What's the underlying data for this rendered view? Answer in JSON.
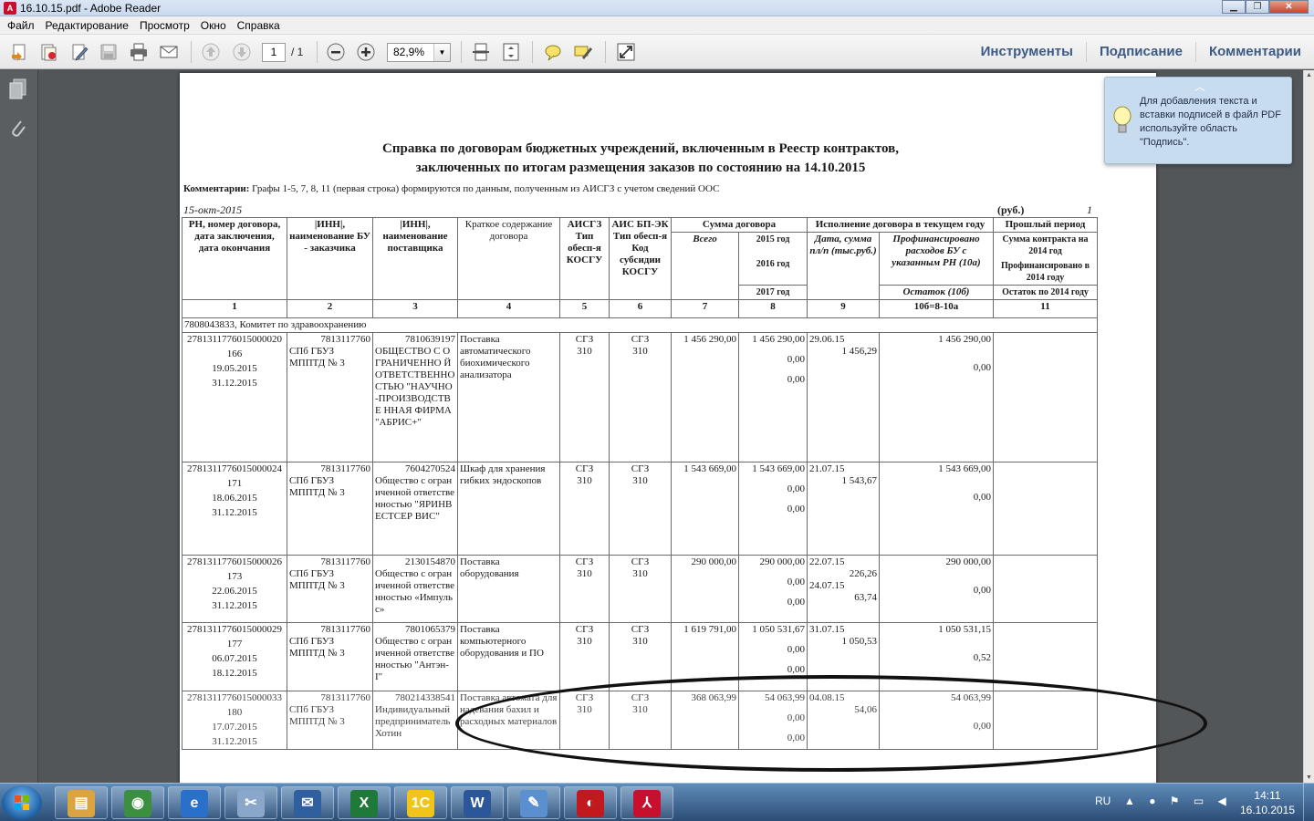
{
  "window": {
    "title": "16.10.15.pdf - Adobe Reader"
  },
  "menu": [
    "Файл",
    "Редактирование",
    "Просмотр",
    "Окно",
    "Справка"
  ],
  "toolbar": {
    "page_current": "1",
    "page_total": "/ 1",
    "zoom": "82,9%",
    "tabs": [
      "Инструменты",
      "Подписание",
      "Комментарии"
    ]
  },
  "tooltip": {
    "text": "Для добавления текста и вставки подписей в файл PDF используйте область \"Подпись\"."
  },
  "document": {
    "title_line1": "Справка по договорам бюджетных учреждений, включенным в Реестр контрактов,",
    "title_line2": "заключенных по итогам размещения заказов по состоянию на 14.10.2015",
    "comment_label": "Комментарии:",
    "comment_text": "Графы 1-5, 7, 8, 11 (первая строка) формируются по данным, полученным из АИСГЗ с учетом сведений ООС",
    "date": "15-окт-2015",
    "currency": "(руб.)",
    "page_no": "1",
    "headers": {
      "h1": "РН, номер договора, дата заключения, дата окончания",
      "h2": "|ИНН|, наименование БУ - заказчика",
      "h3": "|ИНН|, наименование поставщика",
      "h4": "Краткое содержание договора",
      "h5": "АИСГЗ Тип обесп-я КОСГУ",
      "h6": "АИС БП-ЭК Тип обесп-я Код субсидии КОСГУ",
      "h_sum": "Сумма договора",
      "h7": "Всего",
      "h8a": "2015 год",
      "h8b": "2016 год",
      "h8c": "2017 год",
      "h_exec": "Исполнение договора в текущем году",
      "h9": "Дата, сумма пл/п (тыс.руб.)",
      "h10a": "Профинансировано расходов БУ с указанным РН (10а)",
      "h10b": "Остаток (10б)",
      "h_prev": "Прошлый период",
      "h11a": "Сумма контракта на 2014 год",
      "h11b": "Профинансировано в 2014 году",
      "h11c": "Остаток по 2014 году"
    },
    "col_numbers": [
      "1",
      "2",
      "3",
      "4",
      "5",
      "6",
      "7",
      "8",
      "9",
      "10б=8-10а",
      "11"
    ],
    "group": "7808043833, Комитет по здравоохранению",
    "rows": [
      {
        "rn": "2781311776015000020",
        "num": "166",
        "d1": "19.05.2015",
        "d2": "31.12.2015",
        "inn_bu": "7813117760",
        "bu": "СПб ГБУЗ МППТД № 3",
        "inn_sup": "7810639197",
        "sup": "ОБЩЕСТВО С ОГРАНИЧЕННО Й ОТВЕТСТВЕННО СТЬЮ \"НАУЧНО-ПРОИЗВОДСТВЕ ННАЯ ФИРМА \"АБРИС+\"",
        "desc": "Поставка автоматического биохимического анализатора",
        "t5a": "СГЗ",
        "t5b": "310",
        "t6a": "СГЗ",
        "t6b": "310",
        "total": "1 456 290,00",
        "y2015": "1 456 290,00",
        "y2016": "0,00",
        "y2017": "0,00",
        "pay_date": "29.06.15",
        "pay_sum": "1 456,29",
        "pay_date2": "",
        "pay_sum2": "",
        "fin": "1 456 290,00",
        "rest": "0,00"
      },
      {
        "rn": "2781311776015000024",
        "num": "171",
        "d1": "18.06.2015",
        "d2": "31.12.2015",
        "inn_bu": "7813117760",
        "bu": "СПб ГБУЗ МППТД № 3",
        "inn_sup": "7604270524",
        "sup": "Общество с ограниченной ответственностью \"ЯРИНВЕСТСЕР ВИС\"",
        "desc": "Шкаф для хранения гибких эндоскопов",
        "t5a": "СГЗ",
        "t5b": "310",
        "t6a": "СГЗ",
        "t6b": "310",
        "total": "1 543 669,00",
        "y2015": "1 543 669,00",
        "y2016": "0,00",
        "y2017": "0,00",
        "pay_date": "21.07.15",
        "pay_sum": "1 543,67",
        "pay_date2": "",
        "pay_sum2": "",
        "fin": "1 543 669,00",
        "rest": "0,00"
      },
      {
        "rn": "2781311776015000026",
        "num": "173",
        "d1": "22.06.2015",
        "d2": "31.12.2015",
        "inn_bu": "7813117760",
        "bu": "СПб ГБУЗ МППТД № 3",
        "inn_sup": "2130154870",
        "sup": "Общество с ограниченной ответственностью «Импульс»",
        "desc": "Поставка оборудования",
        "t5a": "СГЗ",
        "t5b": "310",
        "t6a": "СГЗ",
        "t6b": "310",
        "total": "290 000,00",
        "y2015": "290 000,00",
        "y2016": "0,00",
        "y2017": "0,00",
        "pay_date": "22.07.15",
        "pay_sum": "226,26",
        "pay_date2": "24.07.15",
        "pay_sum2": "63,74",
        "fin": "290 000,00",
        "rest": "0,00"
      },
      {
        "rn": "2781311776015000029",
        "num": "177",
        "d1": "06.07.2015",
        "d2": "18.12.2015",
        "inn_bu": "7813117760",
        "bu": "СПб ГБУЗ МППТД № 3",
        "inn_sup": "7801065379",
        "sup": "Общество с ограниченной ответственностью \"Антэн-I\"",
        "desc": "Поставка компьютерного оборудования и ПО",
        "t5a": "СГЗ",
        "t5b": "310",
        "t6a": "СГЗ",
        "t6b": "310",
        "total": "1 619 791,00",
        "y2015": "1 050 531,67",
        "y2016": "0,00",
        "y2017": "0,00",
        "pay_date": "31.07.15",
        "pay_sum": "1 050,53",
        "pay_date2": "",
        "pay_sum2": "",
        "fin": "1 050 531,15",
        "rest": "0,52"
      },
      {
        "rn": "2781311776015000033",
        "num": "180",
        "d1": "17.07.2015",
        "d2": "31.12.2015",
        "inn_bu": "7813117760",
        "bu": "СПб ГБУЗ МППТД № 3",
        "inn_sup": "780214338541",
        "sup": "Индивидуальный предприниматель Хотин",
        "desc": "Поставка автомата для надевания бахил и расходных материалов",
        "t5a": "СГЗ",
        "t5b": "310",
        "t6a": "СГЗ",
        "t6b": "310",
        "total": "368 063,99",
        "y2015": "54 063,99",
        "y2016": "0,00",
        "y2017": "0,00",
        "pay_date": "04.08.15",
        "pay_sum": "54,06",
        "pay_date2": "",
        "pay_sum2": "",
        "fin": "54 063,99",
        "rest": "0,00"
      }
    ]
  },
  "taskbar": {
    "lang": "RU",
    "time": "14:11",
    "date": "16.10.2015",
    "apps": [
      {
        "icon": "file-explorer-icon",
        "color": "#d9a441"
      },
      {
        "icon": "chrome-icon",
        "color": "#3b8f3f"
      },
      {
        "icon": "internet-explorer-icon",
        "color": "#2a6fc9"
      },
      {
        "icon": "snipping-tool-icon",
        "color": "#8aa6c8"
      },
      {
        "icon": "mail-client-icon",
        "color": "#2f5f9e"
      },
      {
        "icon": "excel-icon",
        "color": "#1f7a3a"
      },
      {
        "icon": "1c-icon",
        "color": "#f0c419"
      },
      {
        "icon": "word-icon",
        "color": "#2b579a"
      },
      {
        "icon": "paint-icon",
        "color": "#5a8fd0"
      },
      {
        "icon": "presentation-app-icon",
        "color": "#c2191f"
      },
      {
        "icon": "adobe-reader-icon",
        "color": "#c8102e"
      }
    ]
  }
}
